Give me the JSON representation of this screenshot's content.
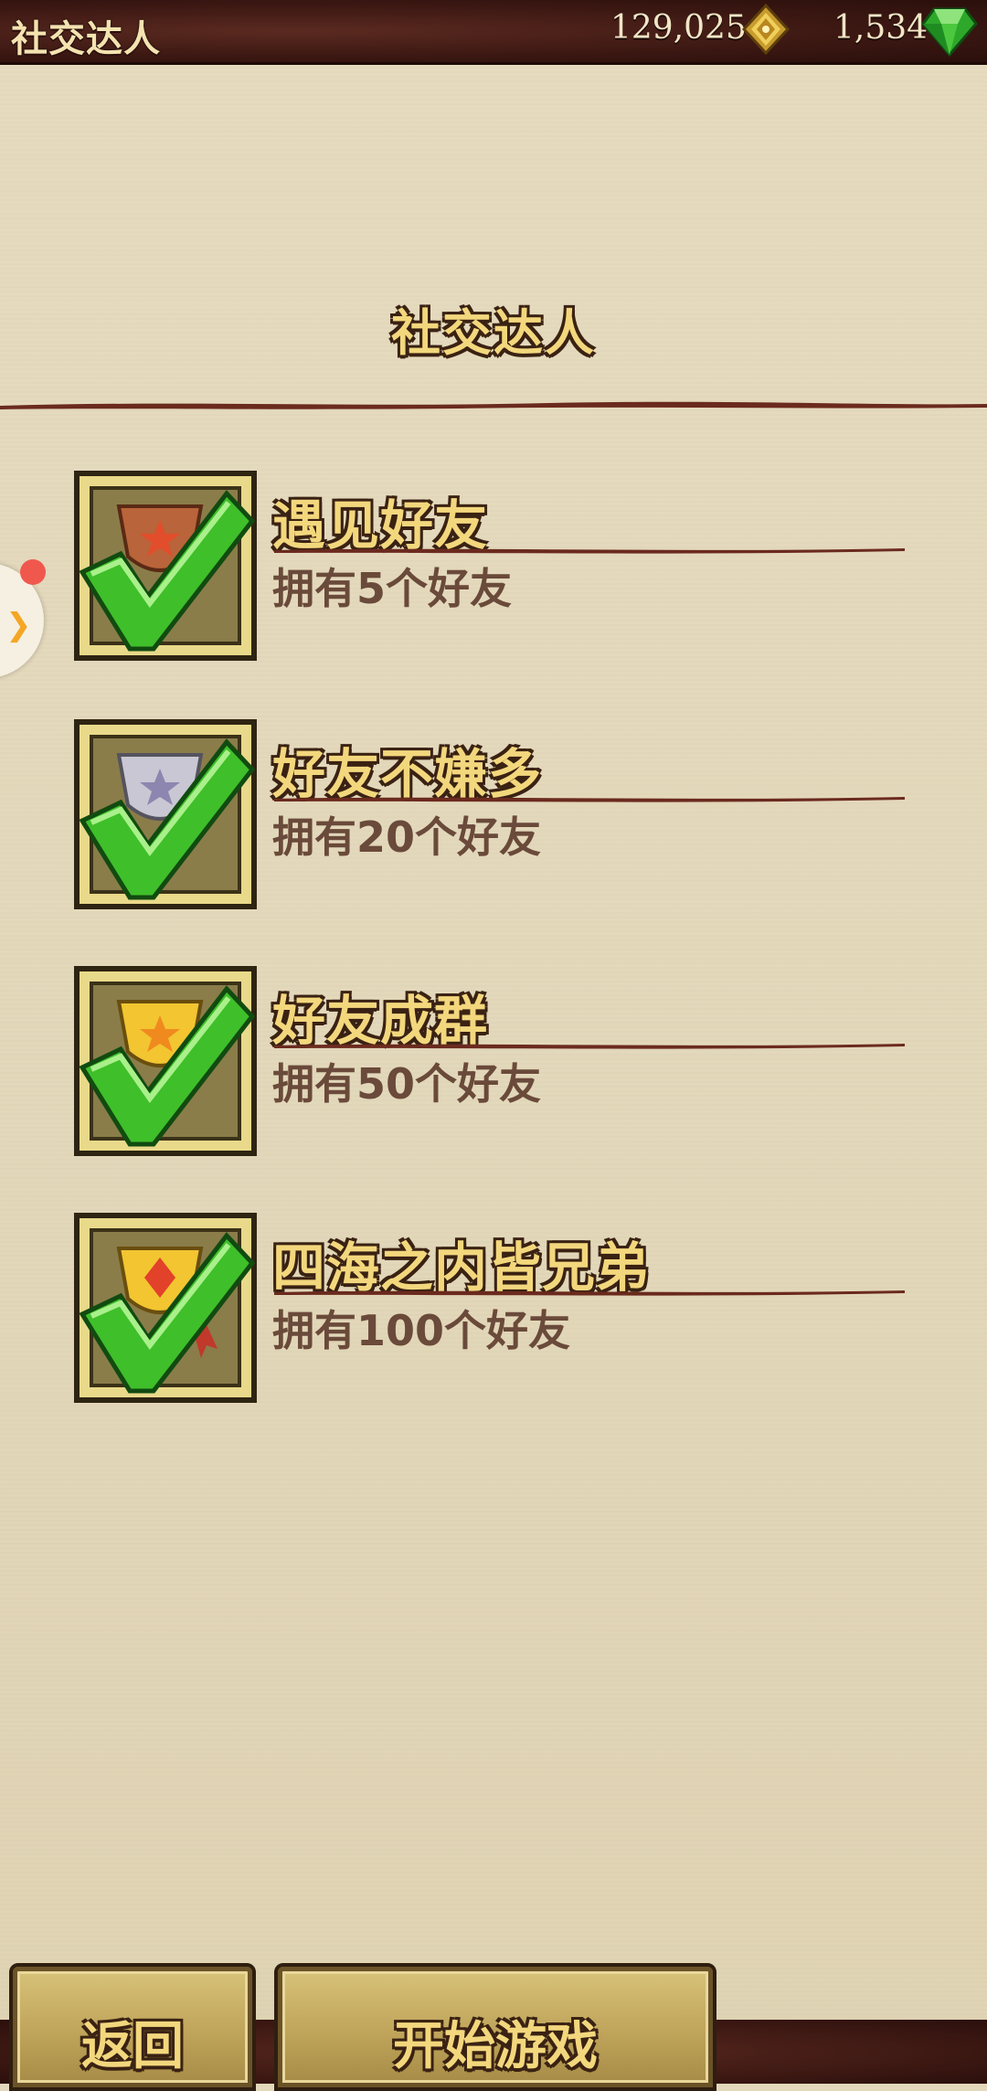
{
  "header": {
    "title": "社交达人",
    "coins": "129,025",
    "gems": "1,534"
  },
  "section": {
    "title": "社交达人"
  },
  "achievements": [
    {
      "title": "遇见好友",
      "desc": "拥有5个好友",
      "cup": "bronze",
      "completed": true
    },
    {
      "title": "好友不嫌多",
      "desc": "拥有20个好友",
      "cup": "silver",
      "completed": true
    },
    {
      "title": "好友成群",
      "desc": "拥有50个好友",
      "cup": "gold",
      "completed": true
    },
    {
      "title": "四海之内皆兄弟",
      "desc": "拥有100个好友",
      "cup": "gold-ribbon",
      "completed": true
    }
  ],
  "buttons": {
    "back": "返回",
    "start": "开始游戏"
  },
  "colors": {
    "gold_text": "#f3d77d",
    "outline": "#3a2213",
    "check_green": "#3fbf2a",
    "topbar": "#3b1712"
  },
  "icons": [
    "gold-diamond-icon",
    "green-gem-icon",
    "trophy-icon",
    "checkmark-icon",
    "expand-arrow-icon"
  ]
}
